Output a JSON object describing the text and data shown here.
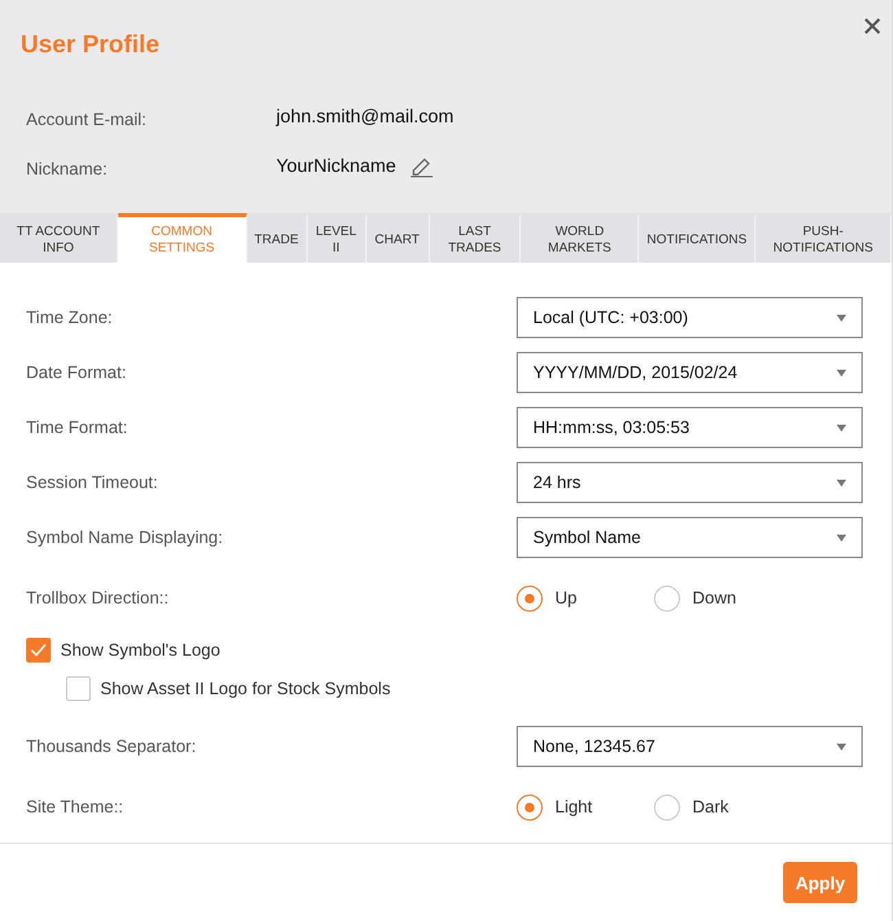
{
  "window": {
    "title": "User Profile"
  },
  "account": [
    {
      "label": "Account E-mail:",
      "value": "john.smith@mail.com",
      "editable": false
    },
    {
      "label": "Nickname:",
      "value": "YourNickname",
      "editable": true
    }
  ],
  "tabs": [
    {
      "label": "TT ACCOUNT\nINFO",
      "selected": false
    },
    {
      "label": "COMMON\nSETTINGS",
      "selected": true
    },
    {
      "label": "TRADE",
      "selected": false
    },
    {
      "label": "LEVEL\nII",
      "selected": false
    },
    {
      "label": "CHART",
      "selected": false
    },
    {
      "label": "LAST\nTRADES",
      "selected": false
    },
    {
      "label": "WORLD\nMARKETS",
      "selected": false
    },
    {
      "label": "NOTIFICATIONS",
      "selected": false
    },
    {
      "label": "PUSH-\nNOTIFICATIONS",
      "selected": false
    }
  ],
  "settings": [
    {
      "kind": "select",
      "label": "Time Zone:",
      "value": "Local (UTC: +03:00)"
    },
    {
      "kind": "select",
      "label": "Date Format:",
      "value": "YYYY/MM/DD, 2015/02/24"
    },
    {
      "kind": "select",
      "label": "Time Format:",
      "value": "HH:mm:ss, 03:05:53"
    },
    {
      "kind": "select",
      "label": "Session Timeout:",
      "value": "24 hrs"
    },
    {
      "kind": "select",
      "label": "Symbol Name Displaying:",
      "value": "Symbol Name"
    },
    {
      "kind": "radio",
      "label": "Trollbox Direction::",
      "options": [
        {
          "label": "Up",
          "selected": true
        },
        {
          "label": "Down",
          "selected": false
        }
      ]
    },
    {
      "kind": "checkbox",
      "label": "Show Symbol's Logo",
      "checked": true,
      "children": [
        {
          "kind": "checkbox",
          "label": "Show Asset II Logo for Stock Symbols",
          "checked": false
        }
      ]
    },
    {
      "kind": "select",
      "label": "Thousands Separator:",
      "value": "None, 12345.67"
    },
    {
      "kind": "radio",
      "label": "Site Theme::",
      "options": [
        {
          "label": "Light",
          "selected": true
        },
        {
          "label": "Dark",
          "selected": false
        }
      ]
    }
  ],
  "buttons": [
    {
      "label": "Apply"
    }
  ]
}
